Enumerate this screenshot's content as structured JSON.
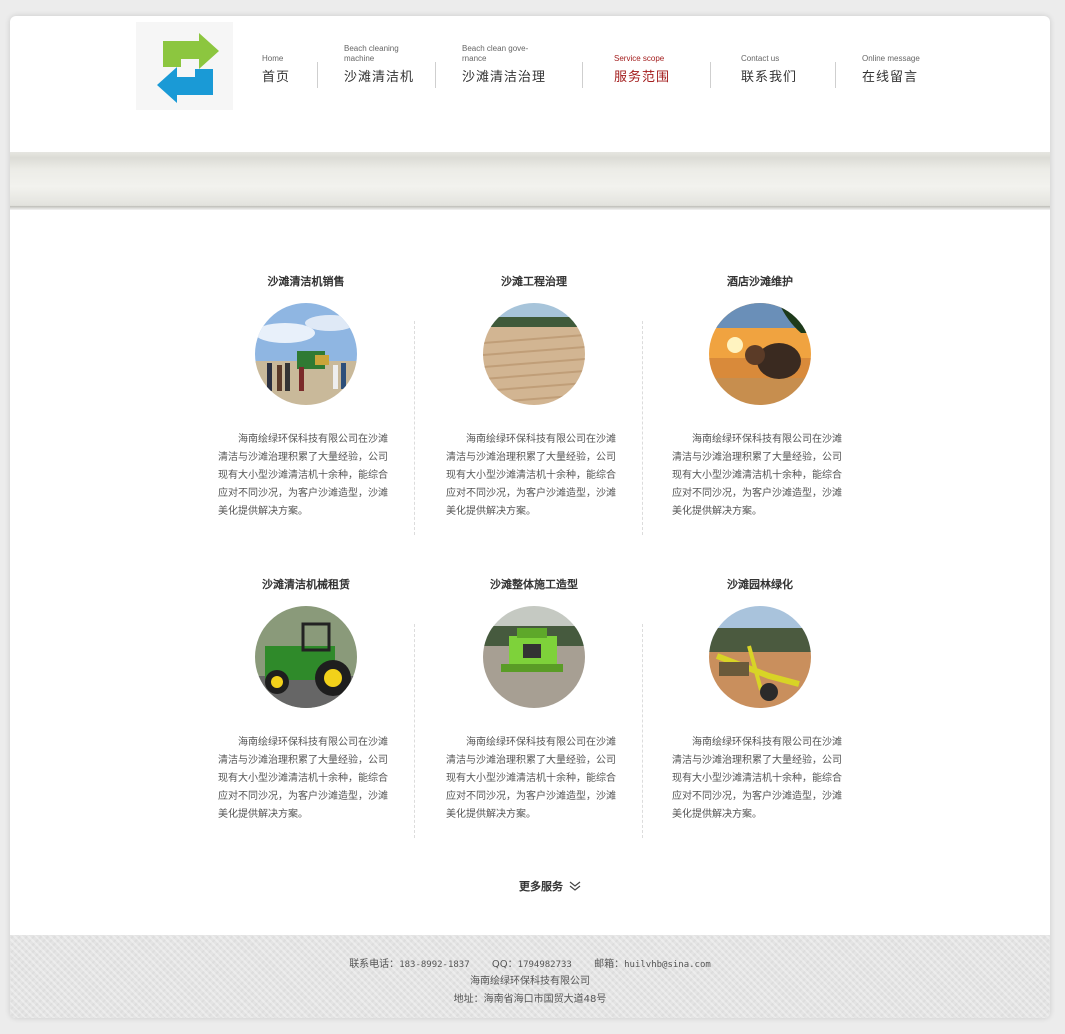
{
  "header": {
    "logo_alt": "logo",
    "nav": [
      {
        "en": "Home",
        "cn": "首页",
        "active": false
      },
      {
        "en": "Beach cleaning\nmachine",
        "cn": "沙滩清洁机",
        "active": false
      },
      {
        "en": "Beach clean gove-\nrnance",
        "cn": "沙滩清洁治理",
        "active": false
      },
      {
        "en": "Service scope",
        "cn": "服务范围",
        "active": true
      },
      {
        "en": "Contact us",
        "cn": "联系我们",
        "active": false
      },
      {
        "en": "Online message",
        "cn": "在线留言",
        "active": false
      }
    ]
  },
  "colors": {
    "accent": "#a31d1d",
    "logo_green": "#8cc63f",
    "logo_blue": "#1a9ad6"
  },
  "services": [
    {
      "title": "沙滩清洁机销售",
      "image": "beach-crowd-photo",
      "desc": "海南绘绿环保科技有限公司在沙滩清洁与沙滩治理积累了大量经验，公司现有大小型沙滩清洁机十余种，能综合应对不同沙况，为客户沙滩造型，沙滩美化提供解决方案。"
    },
    {
      "title": "沙滩工程治理",
      "image": "groomed-sand-photo",
      "desc": "海南绘绿环保科技有限公司在沙滩清洁与沙滩治理积累了大量经验，公司现有大小型沙滩清洁机十余种，能综合应对不同沙况，为客户沙滩造型，沙滩美化提供解决方案。"
    },
    {
      "title": "酒店沙滩维护",
      "image": "sunset-beach-photo",
      "desc": "海南绘绿环保科技有限公司在沙滩清洁与沙滩治理积累了大量经验，公司现有大小型沙滩清洁机十余种，能综合应对不同沙况，为客户沙滩造型，沙滩美化提供解决方案。"
    },
    {
      "title": "沙滩清洁机械租赁",
      "image": "green-tractor-photo",
      "desc": "海南绘绿环保科技有限公司在沙滩清洁与沙滩治理积累了大量经验，公司现有大小型沙滩清洁机十余种，能综合应对不同沙况，为客户沙滩造型，沙滩美化提供解决方案。"
    },
    {
      "title": "沙滩整体施工造型",
      "image": "beach-cleaner-machine-photo",
      "desc": "海南绘绿环保科技有限公司在沙滩清洁与沙滩治理积累了大量经验，公司现有大小型沙滩清洁机十余种，能综合应对不同沙况，为客户沙滩造型，沙滩美化提供解决方案。"
    },
    {
      "title": "沙滩园林绿化",
      "image": "yellow-rake-photo",
      "desc": "海南绘绿环保科技有限公司在沙滩清洁与沙滩治理积累了大量经验，公司现有大小型沙滩清洁机十余种，能综合应对不同沙况，为客户沙滩造型，沙滩美化提供解决方案。"
    }
  ],
  "more_label": "更多服务",
  "footer": {
    "phone_label": "联系电话：",
    "phone": "183-8992-1837",
    "qq_label": "QQ：",
    "qq": "1794982733",
    "email_label": "邮箱：",
    "email": "huilvhb@sina.com",
    "company": "海南绘绿环保科技有限公司",
    "address": "地址：海南省海口市国贸大道48号"
  }
}
